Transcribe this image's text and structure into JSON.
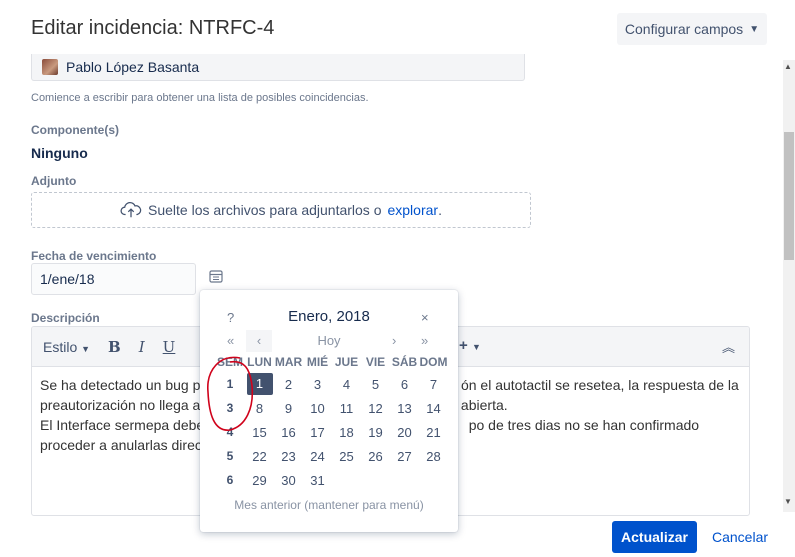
{
  "dialog": {
    "title": "Editar incidencia: NTRFC-4",
    "configure_label": "Configurar campos",
    "configure_chevron": "⌄"
  },
  "assignee": {
    "value": "Pablo López Basanta",
    "hint": "Comience a escribir para obtener una lista de posibles coincidencias."
  },
  "component": {
    "label": "Componente(s)",
    "value": "Ninguno"
  },
  "attachment": {
    "label": "Adjunto",
    "drop_text": "Suelte los archivos para adjuntarlos o",
    "link_text": "explorar",
    "period": "."
  },
  "due_date": {
    "label": "Fecha de vencimiento",
    "value": "1/ene/18"
  },
  "description": {
    "label": "Descripción",
    "toolbar": {
      "style_label": "Estilo",
      "bold": "B",
      "italic": "I",
      "underline": "U",
      "plus": "+"
    },
    "text_lines": [
      "Se ha detectado un bug p                                                                   ón el autotactil se resetea, la respuesta de la",
      "preautorización no llega a                                                                   abierta.",
      "El Interface sermepa debe                                                                    po de tres dias no se han confirmado",
      "proceder a anularlas direct"
    ]
  },
  "datepicker": {
    "help": "?",
    "title": "Enero, 2018",
    "close": "×",
    "prev_year": "«",
    "prev_month": "‹",
    "today": "Hoy",
    "next_month": "›",
    "next_year": "»",
    "headers": [
      "SEM",
      "LUN",
      "MAR",
      "MIÉ",
      "JUE",
      "VIE",
      "SÁB",
      "DOM"
    ],
    "weeks": [
      {
        "wk": "1",
        "days": [
          "1",
          "2",
          "3",
          "4",
          "5",
          "6",
          "7"
        ]
      },
      {
        "wk": "3",
        "days": [
          "8",
          "9",
          "10",
          "11",
          "12",
          "13",
          "14"
        ]
      },
      {
        "wk": "4",
        "days": [
          "15",
          "16",
          "17",
          "18",
          "19",
          "20",
          "21"
        ]
      },
      {
        "wk": "5",
        "days": [
          "22",
          "23",
          "24",
          "25",
          "26",
          "27",
          "28"
        ]
      },
      {
        "wk": "6",
        "days": [
          "29",
          "30",
          "31",
          "",
          "",
          "",
          ""
        ]
      }
    ],
    "selected_day": "1",
    "footer": "Mes anterior (mantener para menú)"
  },
  "actions": {
    "update_label": "Actualizar",
    "cancel_label": "Cancelar"
  },
  "colors": {
    "primary": "#0052cc",
    "annotation": "#d0021b",
    "selected_day_bg": "#42526e"
  }
}
